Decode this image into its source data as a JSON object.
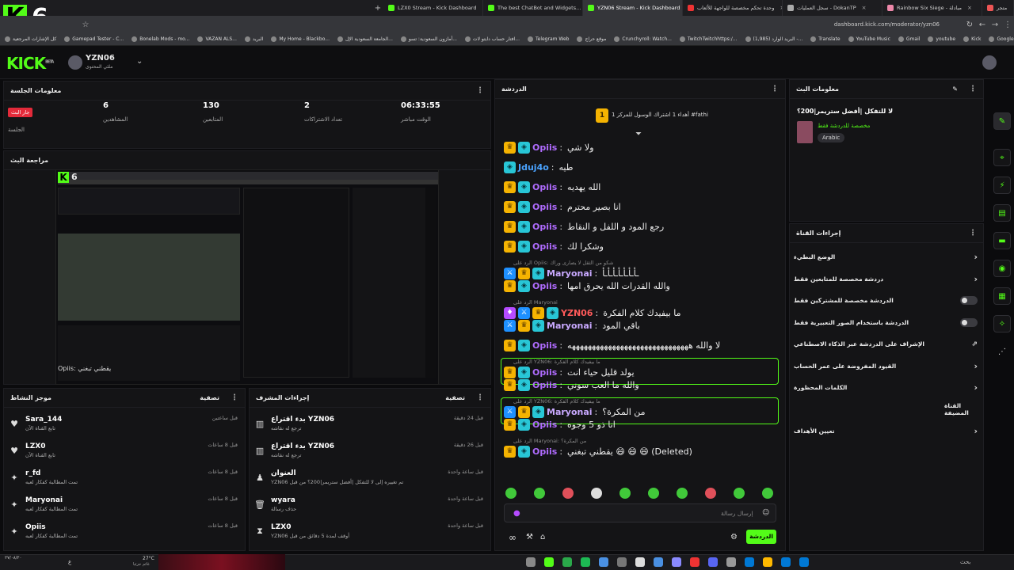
{
  "browser": {
    "tabs": [
      {
        "label": "LZX0 Stream - Kick Dashboard",
        "color": "#53fc18"
      },
      {
        "label": "The best ChatBot and Widgets...",
        "color": "#53fc18"
      },
      {
        "label": "YZN06 Stream - Kick Dashboard",
        "color": "#53fc18",
        "active": true
      },
      {
        "label": "وحدة تحكم مخصصة للواجهة للألعاب",
        "color": "#e33"
      },
      {
        "label": "سجل العمليات - DokanTP",
        "color": "#aaa"
      },
      {
        "label": "Rainbow Six Siege - مبادلة",
        "color": "#e8a"
      },
      {
        "label": "متجر",
        "color": "#e55"
      }
    ],
    "url": "dashboard.kick.com/moderator/yzn06",
    "bookmarks": [
      "كل الإشارات المرجعية",
      "Gamepad Tester - C...",
      "Bonelab Mods - mo...",
      "VAZAN ALS...",
      "البريد",
      "My Home - Blackbo...",
      "الجامعة السعودية الإل...",
      "أمازون السعودية: تسو...",
      "افتار حساب دايتو لات...",
      "Telegram Web",
      "موقع حراج",
      "Crunchyroll: Watch...",
      "TwitchTwitchhttps:/...",
      "(1,985) البريد الوارد -...",
      "Translate",
      "YouTube Music",
      "Gmail",
      "youtube",
      "Kick",
      "Google"
    ]
  },
  "overlay_logo": {
    "letter": "K",
    "number": "6"
  },
  "header": {
    "logo": "KICK",
    "logo_sup": "BETA",
    "username": "YZN06",
    "subtitle": "ملئي المحتوى"
  },
  "session": {
    "title": "معلومات الجلسة",
    "live_badge": "جار البث",
    "live_label": "الجلسة",
    "stats": [
      {
        "value": "6",
        "label": "المشاهدين"
      },
      {
        "value": "130",
        "label": "المتابعين"
      },
      {
        "value": "2",
        "label": "تعداد الاشتراكات"
      },
      {
        "value": "06:33:55",
        "label": "الوقت مباشر"
      }
    ]
  },
  "preview": {
    "title": "مراجعة البث",
    "overlay_text": "Opiis: يقطني تبغني"
  },
  "activity": {
    "title": "موجز النشاط",
    "filter": "تصفية",
    "items": [
      {
        "icon": "heart-icon",
        "name": "Sara_144",
        "sub": "تابع القناة الآن",
        "time": "قبل ساعتين"
      },
      {
        "icon": "heart-icon",
        "name": "LZX0",
        "sub": "تابع القناة الآن",
        "time": "قبل 8 ساعات"
      },
      {
        "icon": "gift-icon",
        "name": "r_fd",
        "sub": "تمت المطالبة كفكار لعبه",
        "time": "قبل 8 ساعات"
      },
      {
        "icon": "gift-icon",
        "name": "Maryonai",
        "sub": "تمت المطالبة كفكار لعبه",
        "time": "قبل 8 ساعات"
      },
      {
        "icon": "gift-icon",
        "name": "Opiis",
        "sub": "تمت المطالبة كفكار لعبه",
        "time": "قبل 8 ساعات"
      }
    ]
  },
  "modactions": {
    "title": "إجراءات المشرف",
    "filter": "تصفية",
    "items": [
      {
        "icon": "chart-icon",
        "name": "بدء اقتراع YZN06",
        "sub": "ترجع له نقاشه",
        "time": "قبل 24 دقيقة"
      },
      {
        "icon": "chart-icon",
        "name": "بدء اقتراع YZN06",
        "sub": "ترجع له نقاشه",
        "time": "قبل 26 دقيقة"
      },
      {
        "icon": "person-icon",
        "name": "العنوان",
        "sub": "YZN06 تم تغييره إلى لا للتفكل |أفضل ستريمر|200؟ من قبل",
        "time": "قبل ساعة واحدة"
      },
      {
        "icon": "trash-icon",
        "name": "wyara",
        "sub": "حذف رسالة",
        "time": "قبل ساعة واحدة"
      },
      {
        "icon": "hourglass-icon",
        "name": "LZX0",
        "sub": "YZN06 أوقف لمدة 5 دقائق من قبل",
        "time": "قبل ساعة واحدة"
      }
    ]
  },
  "chat": {
    "title": "الدردشة",
    "pinned": "أهداء 1 اشتراك الوسول للمركز 1 #fathi",
    "pinned_rank": "1",
    "messages": [
      {
        "user": "Opiis",
        "color": "#b06cff",
        "badges": [
          "crown",
          "sub"
        ],
        "text": "ولا شي"
      },
      {
        "user": "Jduj4o",
        "color": "#4aa3ff",
        "badges": [
          "sub"
        ],
        "text": "طيه"
      },
      {
        "user": "Opiis",
        "color": "#b06cff",
        "badges": [
          "crown",
          "sub"
        ],
        "text": "الله يهديه"
      },
      {
        "user": "Opiis",
        "color": "#b06cff",
        "badges": [
          "crown",
          "sub"
        ],
        "text": "انا بصير محترم"
      },
      {
        "user": "Opiis",
        "color": "#b06cff",
        "badges": [
          "crown",
          "sub"
        ],
        "text": "رجع المود و اللفل و النقاط"
      },
      {
        "user": "Opiis",
        "color": "#b06cff",
        "badges": [
          "crown",
          "sub"
        ],
        "text": "وشكرا لك"
      },
      {
        "user": "Maryonai",
        "color": "#c9a9ff",
        "badges": [
          "mod",
          "crown",
          "sub"
        ],
        "text": "ـأـأـأـأـأـأـأ",
        "reply": "الرد على Opiis: شكو من الثقل لا يصارى وراك"
      },
      {
        "user": "Opiis",
        "color": "#b06cff",
        "badges": [
          "crown",
          "sub"
        ],
        "text": "والله القدرات الله يحرق امها"
      },
      {
        "user": "YZN06",
        "color": "#ff5a5a",
        "badges": [
          "vip",
          "mod",
          "crown",
          "sub"
        ],
        "text": "ما بيفيدك كلام الفكرة",
        "reply": "الرد على Maryonai"
      },
      {
        "user": "Maryonai",
        "color": "#c9a9ff",
        "badges": [
          "mod",
          "crown",
          "sub"
        ],
        "text": "باقي المود"
      },
      {
        "user": "Opiis",
        "color": "#b06cff",
        "badges": [
          "crown",
          "sub"
        ],
        "text": "لا والله ههههههههههههههههههههههههههههههه"
      },
      {
        "user": "Opiis",
        "color": "#b06cff",
        "badges": [
          "crown",
          "sub"
        ],
        "text": "يولد قليل حياء انت",
        "reply": "الرد على YZN06: ما بيفيدك كلام الفكرة",
        "highlight": true
      },
      {
        "user": "Opiis",
        "color": "#b06cff",
        "badges": [
          "crown",
          "sub"
        ],
        "text": "والله ما العب سوني"
      },
      {
        "user": "Maryonai",
        "color": "#c9a9ff",
        "badges": [
          "mod",
          "crown",
          "sub"
        ],
        "text": "من المكرة؟",
        "reply": "الرد على YZN06: ما بيفيدك كلام الفكرة",
        "highlight": true
      },
      {
        "user": "Opiis",
        "color": "#b06cff",
        "badges": [
          "crown",
          "sub"
        ],
        "text": "انا ذو 5 وجوه"
      },
      {
        "user": "Opiis",
        "color": "#b06cff",
        "badges": [
          "crown",
          "sub"
        ],
        "text": "يقطني تبغني 😄 😄 😄 (Deleted)",
        "reply": "الرد على Maryonai: من المكرة؟"
      }
    ],
    "input_placeholder": "إرسال رسالة",
    "send_label": "الدردشة"
  },
  "stream_info": {
    "title": "معلومات البث",
    "stream_title": "لا للتفكل |أفضل ستريمر|200؟",
    "category": "مخصصة للدردشة فقط",
    "language": "Arabic"
  },
  "channel_actions": {
    "title": "إجراءات القناة",
    "items": [
      {
        "label": "الوضع البطيء",
        "control": "chevron"
      },
      {
        "label": "دردشة مخصصة للمتابعين فقط",
        "control": "chevron"
      },
      {
        "label": "الدردشة مخصصة للمشتركين فقط",
        "control": "toggle"
      },
      {
        "label": "الدردشة باستخدام الصور التعبيرية فقط",
        "control": "toggle"
      },
      {
        "label": "الإشراف على الدردشة عبر الذكاء الاصطناعي",
        "control": "external"
      },
      {
        "label": "القيود المفروضة على عمر الحساب",
        "control": "chevron"
      },
      {
        "label": "الكلمات المحظورة",
        "control": "chevron"
      },
      {
        "label": "القناة المضيفة",
        "control": "none"
      },
      {
        "label": "تعيين الأهداف",
        "control": "chevron"
      }
    ]
  },
  "taskbar": {
    "weather": "27°C",
    "weather_sub": "غائم جزئيا",
    "time": "٢٧/٠٨/٢٠",
    "lang": "ع",
    "search": "بحث"
  }
}
